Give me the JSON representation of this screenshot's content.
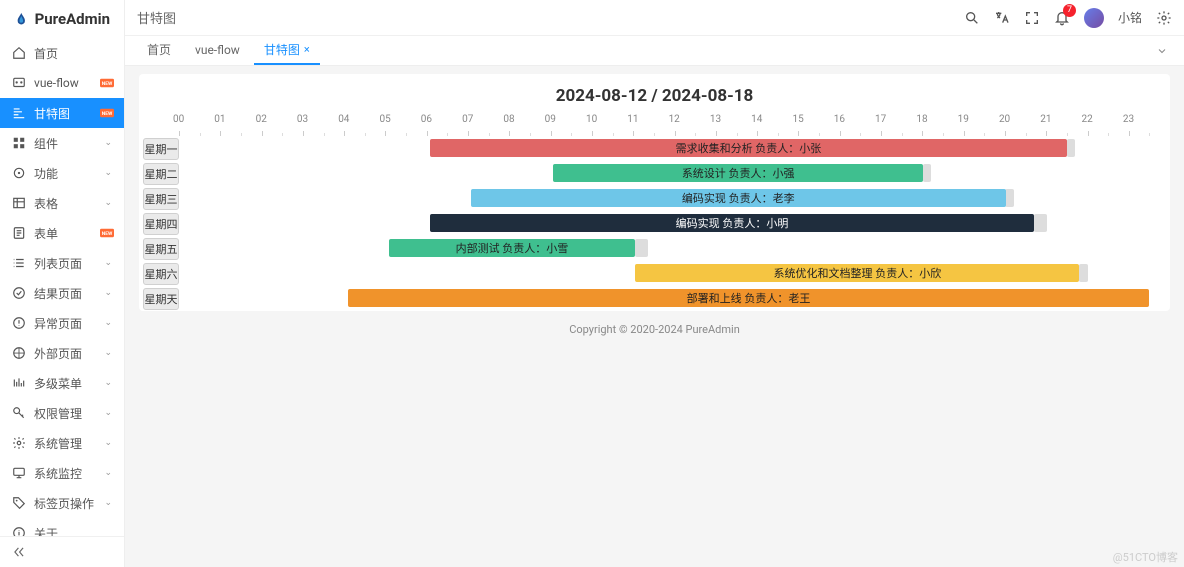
{
  "app_name": "PureAdmin",
  "breadcrumb": "甘特图",
  "sidebar": {
    "items": [
      {
        "label": "首页",
        "icon": "home",
        "active": false
      },
      {
        "label": "vue-flow",
        "icon": "flow",
        "active": false,
        "new": true
      },
      {
        "label": "甘特图",
        "icon": "gantt",
        "active": true,
        "new": true
      },
      {
        "label": "组件",
        "icon": "grid",
        "chev": true
      },
      {
        "label": "功能",
        "icon": "settings-alt",
        "chev": true
      },
      {
        "label": "表格",
        "icon": "table",
        "chev": true
      },
      {
        "label": "表单",
        "icon": "form",
        "chev": true,
        "new": true
      },
      {
        "label": "列表页面",
        "icon": "list",
        "chev": true
      },
      {
        "label": "结果页面",
        "icon": "check-circle",
        "chev": true
      },
      {
        "label": "异常页面",
        "icon": "alert",
        "chev": true
      },
      {
        "label": "外部页面",
        "icon": "external",
        "chev": true
      },
      {
        "label": "多级菜单",
        "icon": "bars",
        "chev": true
      },
      {
        "label": "权限管理",
        "icon": "key",
        "chev": true
      },
      {
        "label": "系统管理",
        "icon": "gear",
        "chev": true
      },
      {
        "label": "系统监控",
        "icon": "monitor",
        "chev": true
      },
      {
        "label": "标签页操作",
        "icon": "tag",
        "chev": true
      },
      {
        "label": "关于",
        "icon": "info",
        "chev": false
      }
    ]
  },
  "topbar": {
    "notification_count": "7",
    "username": "小铭"
  },
  "tabs": [
    {
      "label": "首页",
      "closable": false
    },
    {
      "label": "vue-flow",
      "closable": false
    },
    {
      "label": "甘特图",
      "closable": true,
      "active": true
    }
  ],
  "gantt": {
    "title": "2024-08-12 / 2024-08-18",
    "hours": [
      "00",
      "01",
      "02",
      "03",
      "04",
      "05",
      "06",
      "07",
      "08",
      "09",
      "10",
      "11",
      "12",
      "13",
      "14",
      "15",
      "16",
      "17",
      "18",
      "19",
      "20",
      "21",
      "22",
      "23"
    ],
    "rows": [
      {
        "day": "星期一",
        "bar": {
          "label": "需求收集和分析 负责人：小张",
          "color": "#e06666",
          "start": 6.0,
          "end": 21.5,
          "shadowEnd": 21.7
        }
      },
      {
        "day": "星期二",
        "bar": {
          "label": "系统设计 负责人：小强",
          "color": "#3fbf8f",
          "start": 9.0,
          "end": 18.0,
          "shadowEnd": 18.2
        }
      },
      {
        "day": "星期三",
        "bar": {
          "label": "编码实现 负责人：老李",
          "color": "#6ec6e8",
          "start": 7.0,
          "end": 20.0,
          "shadowEnd": 20.2
        }
      },
      {
        "day": "星期四",
        "bar": {
          "label": "编码实现 负责人：小明",
          "color": "#1f2d3d",
          "start": 6.0,
          "end": 20.7,
          "shadowEnd": 21.0
        }
      },
      {
        "day": "星期五",
        "bar": {
          "label": "内部测试 负责人：小雪",
          "color": "#3fbf8f",
          "start": 5.0,
          "end": 11.0,
          "shadowEnd": 11.3
        }
      },
      {
        "day": "星期六",
        "bar": {
          "label": "系统优化和文档整理 负责人：小欣",
          "color": "#f5c542",
          "start": 11.0,
          "end": 21.8,
          "shadowEnd": 22.0
        }
      },
      {
        "day": "星期天",
        "bar": {
          "label": "部署和上线 负责人：老王",
          "color": "#f0932b",
          "start": 4.0,
          "end": 23.5,
          "shadowEnd": 23.5
        }
      }
    ]
  },
  "footer": "Copyright © 2020-2024 PureAdmin",
  "watermark": "@51CTO博客"
}
